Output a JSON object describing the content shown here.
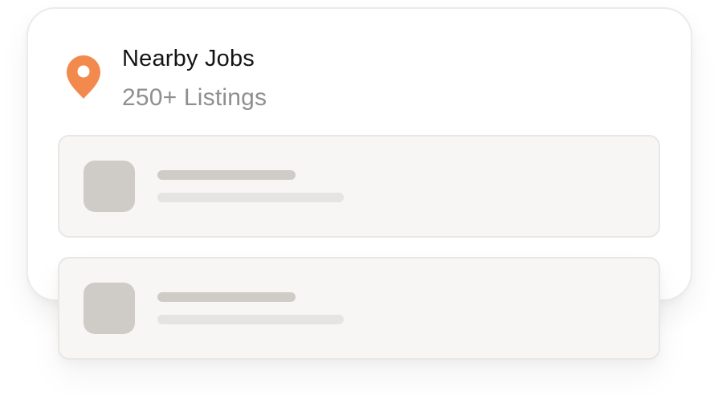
{
  "header": {
    "title": "Nearby Jobs",
    "subtitle": "250+ Listings",
    "icon": "map-pin-icon",
    "icon_color": "#f28a4e"
  },
  "listings": [
    {
      "state": "loading-placeholder"
    },
    {
      "state": "loading-placeholder"
    }
  ],
  "colors": {
    "card_background": "#ffffff",
    "row_background": "#f7f6f4",
    "skeleton_dark": "#cfccc8",
    "skeleton_light": "#e6e4e1",
    "subtitle_text": "#8f8f8f"
  }
}
